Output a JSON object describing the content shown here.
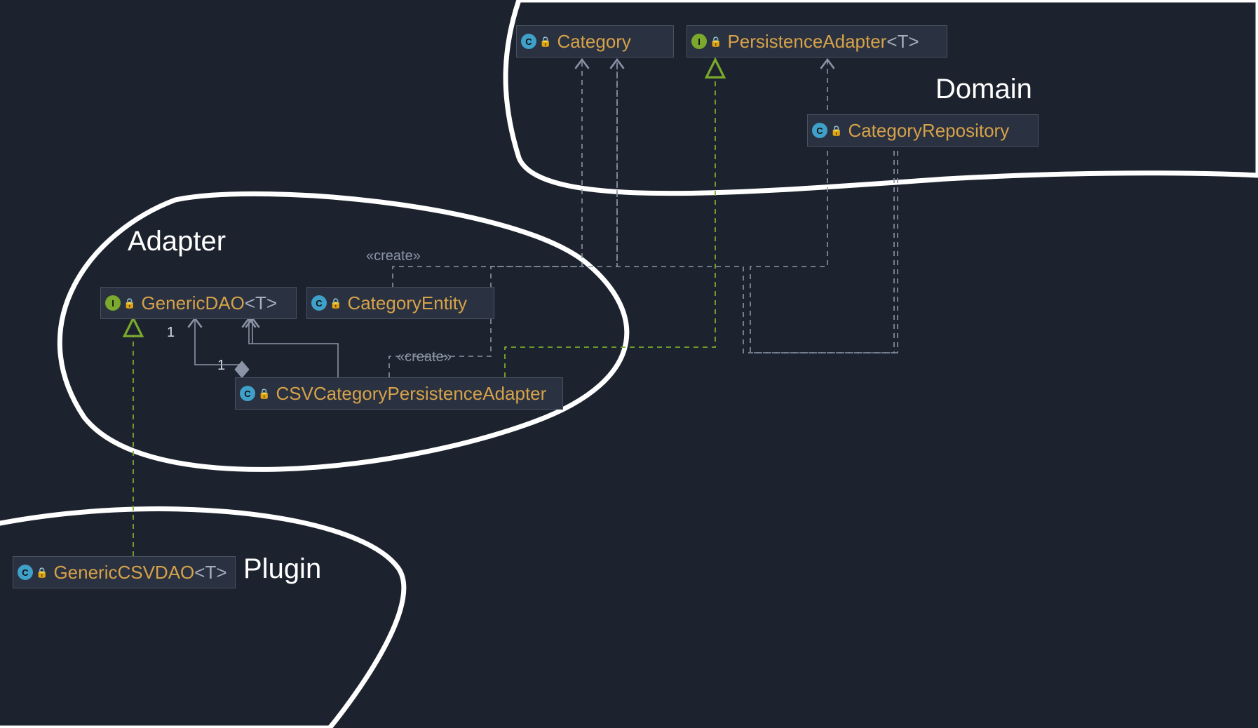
{
  "regions": {
    "domain": "Domain",
    "adapter": "Adapter",
    "plugin": "Plugin"
  },
  "nodes": {
    "category": {
      "kind": "C",
      "name": "Category",
      "generic": ""
    },
    "persAdapter": {
      "kind": "I",
      "name": "PersistenceAdapter",
      "generic": "<T>"
    },
    "catRepo": {
      "kind": "C",
      "name": "CategoryRepository",
      "generic": ""
    },
    "genericDAO": {
      "kind": "I",
      "name": "GenericDAO",
      "generic": "<T>"
    },
    "catEntity": {
      "kind": "C",
      "name": "CategoryEntity",
      "generic": ""
    },
    "csvAdapter": {
      "kind": "C",
      "name": "CSVCategoryPersistenceAdapter",
      "generic": ""
    },
    "csvDAO": {
      "kind": "C",
      "name": "GenericCSVDAO",
      "generic": "<T>"
    }
  },
  "stereotypes": {
    "create1": "«create»",
    "create2": "«create»"
  },
  "multiplicities": {
    "m1": "1",
    "m2": "1"
  }
}
